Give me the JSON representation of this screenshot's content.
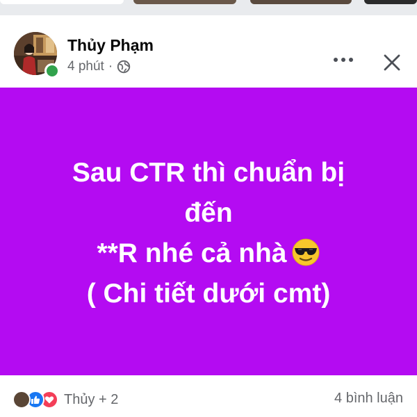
{
  "post": {
    "author": {
      "name": "Thủy Phạm",
      "online": true
    },
    "meta": {
      "time": "4 phút",
      "separator": "·",
      "privacy_icon": "globe-icon"
    },
    "actions": {
      "more_icon": "more-horizontal-icon",
      "close_icon": "close-icon"
    },
    "content": {
      "background_color": "#b40bf2",
      "text_color": "#ffffff",
      "lines": [
        "Sau CTR thì chuẩn bị",
        "đến",
        "**R nhé cả nhà",
        "( Chi tiết dưới cmt)"
      ],
      "emoji": "smiling-face-with-sunglasses"
    },
    "footer": {
      "reaction_icons": [
        "reactor-avatar",
        "like-icon",
        "love-icon"
      ],
      "reactors": "Thủy + 2",
      "comments": "4 bình luận"
    }
  },
  "colors": {
    "like_blue": "#1877f2",
    "love_red": "#f33e58",
    "online_green": "#31a24c",
    "secondary_text": "#65676b"
  }
}
